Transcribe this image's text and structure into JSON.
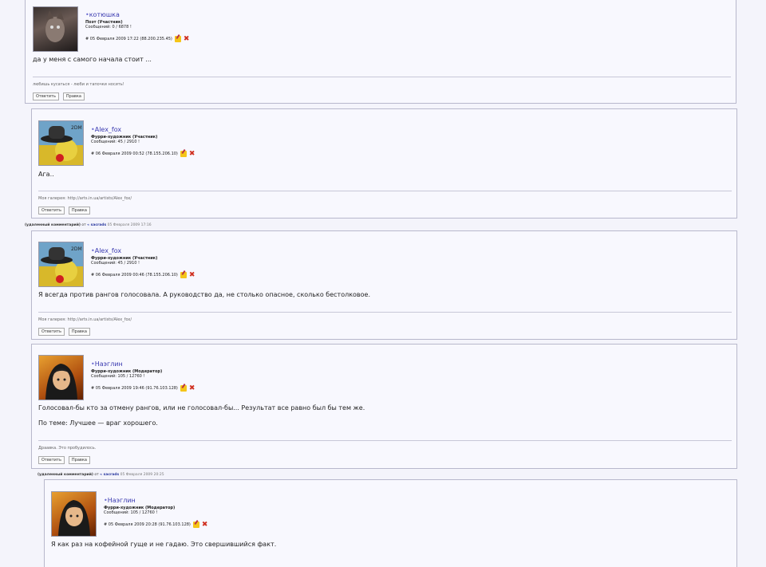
{
  "posts": [
    {
      "author": "котюшка",
      "role": "Поэт (Участник)",
      "messages": "Сообщений: 0 / 6878 !",
      "date": "# 05 Февраля 2009 17:22 (88.200.235.45)",
      "text": [
        "да у меня с самого начала стоит ..."
      ],
      "signature": "любишь кусаться - люби и тапочки носить!",
      "reply": "Ответить",
      "edit": "Правка"
    },
    {
      "author": "Alex_fox",
      "role": "Фурри-художник (Участник)",
      "messages": "Сообщений: 45 / 2910 !",
      "date": "# 06 Февраля 2009 00:52 (78.155.206.10)",
      "text": [
        "Ага.."
      ],
      "signature": "Моя галерея: http://arts.in.ua/artists/Alex_fox/",
      "reply": "Ответить",
      "edit": "Правка"
    },
    {
      "author": "Alex_fox",
      "role": "Фурри-художник (Участник)",
      "messages": "Сообщений: 45 / 2910 !",
      "date": "# 06 Февраля 2009 00:46 (78.155.206.10)",
      "text": [
        "Я всегда против рангов голосовала. А руководство да, не столько опасное, сколько бестолковое."
      ],
      "signature": "Моя галерея: http://arts.in.ua/artists/Alex_fox/",
      "reply": "Ответить",
      "edit": "Правка"
    },
    {
      "author": "Наэглин",
      "role": "Фурри-художник (Модератор)",
      "messages": "Сообщений: 105 / 12760 !",
      "date": "# 05 Февраля 2009 19:46 (91.76.103.128)",
      "text": [
        "Голосовал-бы кто за отмену рангов, или не голосовал-бы... Результат все равно был бы тем же.",
        "По теме: Лучшее — враг хорошего."
      ],
      "signature": "Драавка. Это пробудилось.",
      "reply": "Ответить",
      "edit": "Правка"
    },
    {
      "author": "Наэглин",
      "role": "Фурри-художник (Модератор)",
      "messages": "Сообщений: 105 / 12760 !",
      "date": "# 05 Февраля 2009 20:28 (91.76.103.128)",
      "text": [
        "Я как раз на кофейной гуще и не гадаю. Это свершившийся факт."
      ]
    }
  ],
  "deleted": [
    {
      "label": "(удаленный комментарий)",
      "from": "от",
      "who": "« sacrads",
      "when": "05 Февраля 2009 17:16"
    },
    {
      "label": "(удаленный комментарий)",
      "from": "от",
      "who": "« sacrads",
      "when": "05 Февраля 2009 20:25"
    }
  ],
  "avatar_badge": "2DM",
  "colors": {
    "author": "#3a3ab0",
    "delete": "#d03020",
    "edit": "#f5c518",
    "border": "#b8b8cc"
  }
}
